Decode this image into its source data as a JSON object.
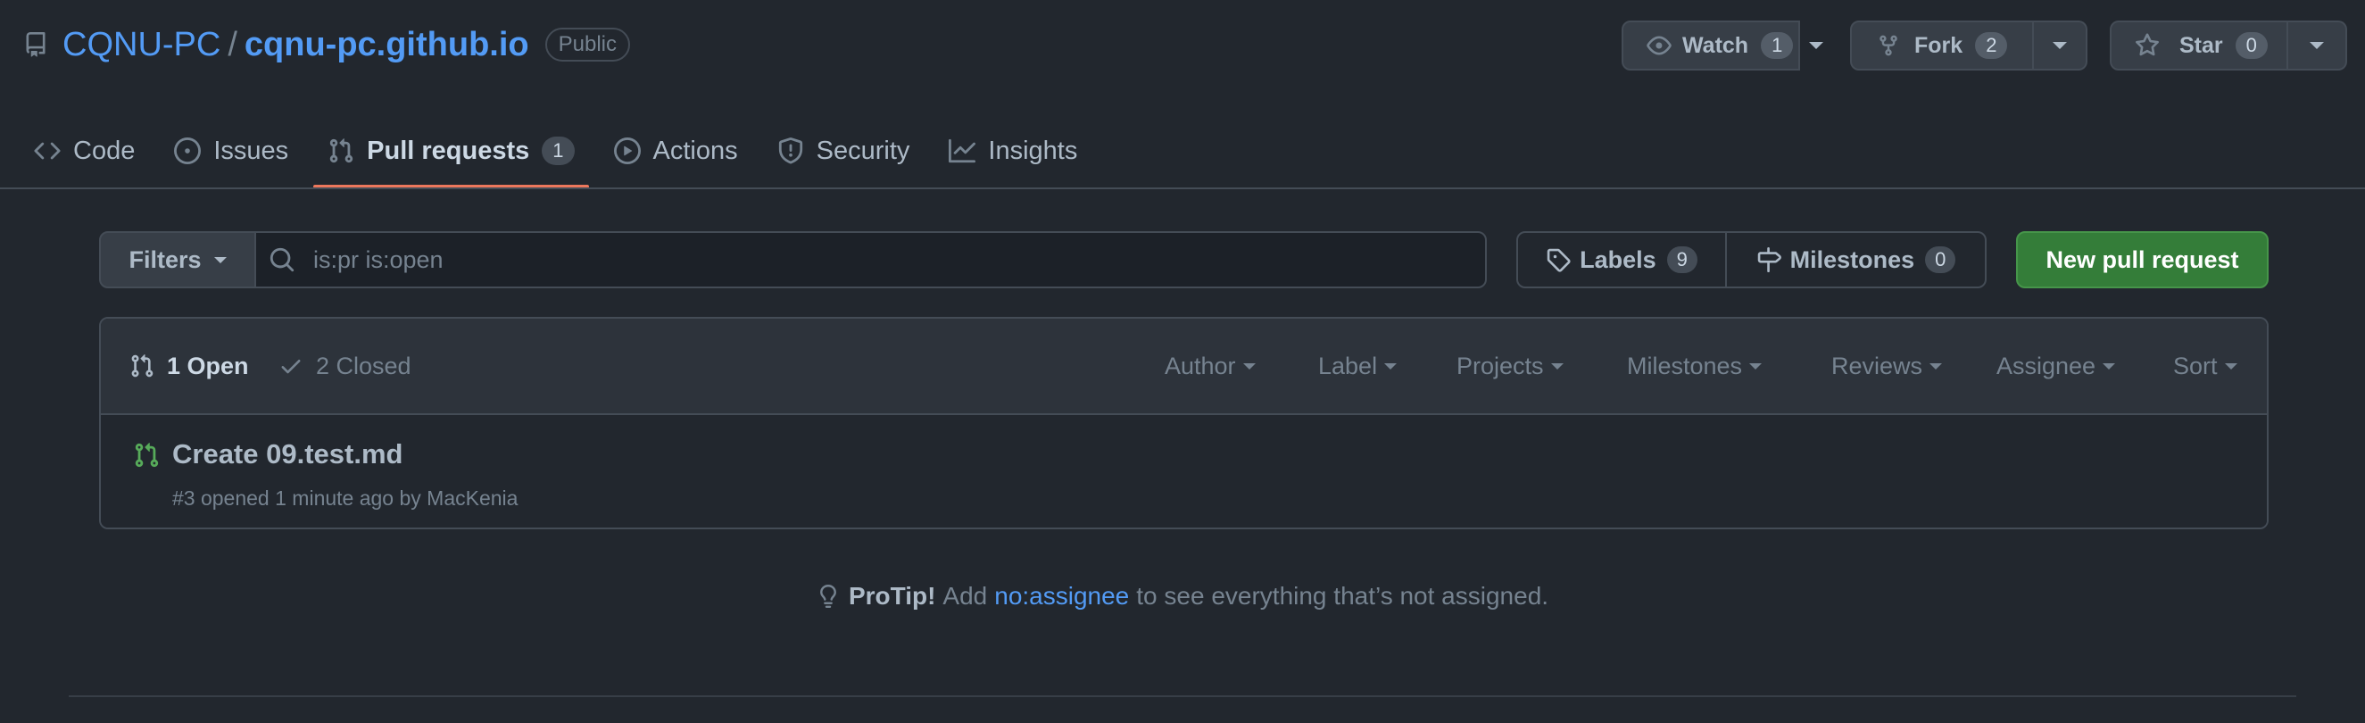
{
  "repo": {
    "owner": "CQNU-PC",
    "separator": "/",
    "name": "cqnu-pc.github.io",
    "visibility": "Public"
  },
  "actions": {
    "watch": {
      "label": "Watch",
      "count": "1"
    },
    "fork": {
      "label": "Fork",
      "count": "2"
    },
    "star": {
      "label": "Star",
      "count": "0"
    }
  },
  "tabs": [
    {
      "label": "Code",
      "icon": "code-icon"
    },
    {
      "label": "Issues",
      "icon": "issue-icon"
    },
    {
      "label": "Pull requests",
      "icon": "pull-request-icon",
      "count": "1",
      "active": true
    },
    {
      "label": "Actions",
      "icon": "play-icon"
    },
    {
      "label": "Security",
      "icon": "shield-icon"
    },
    {
      "label": "Insights",
      "icon": "graph-icon"
    }
  ],
  "toolbar": {
    "filters_label": "Filters",
    "search_value": "is:pr is:open",
    "labels": {
      "label": "Labels",
      "count": "9"
    },
    "milestones": {
      "label": "Milestones",
      "count": "0"
    },
    "new_pr_label": "New pull request"
  },
  "list": {
    "open_label": "1 Open",
    "closed_label": "2 Closed",
    "sort_menus": [
      "Author",
      "Label",
      "Projects",
      "Milestones",
      "Reviews",
      "Assignee",
      "Sort"
    ],
    "items": [
      {
        "title": "Create 09.test.md",
        "meta": "#3 opened 1 minute ago by MacKenia"
      }
    ]
  },
  "protip": {
    "lead": "ProTip!",
    "prefix": "Add",
    "link": "no:assignee",
    "suffix": "to see everything that’s not assigned."
  },
  "colors": {
    "background": "#22272e",
    "link": "#539bf5",
    "primary_button": "#347d39",
    "open_pr_icon": "#57ab5a",
    "active_tab_underline": "#ec775c"
  }
}
